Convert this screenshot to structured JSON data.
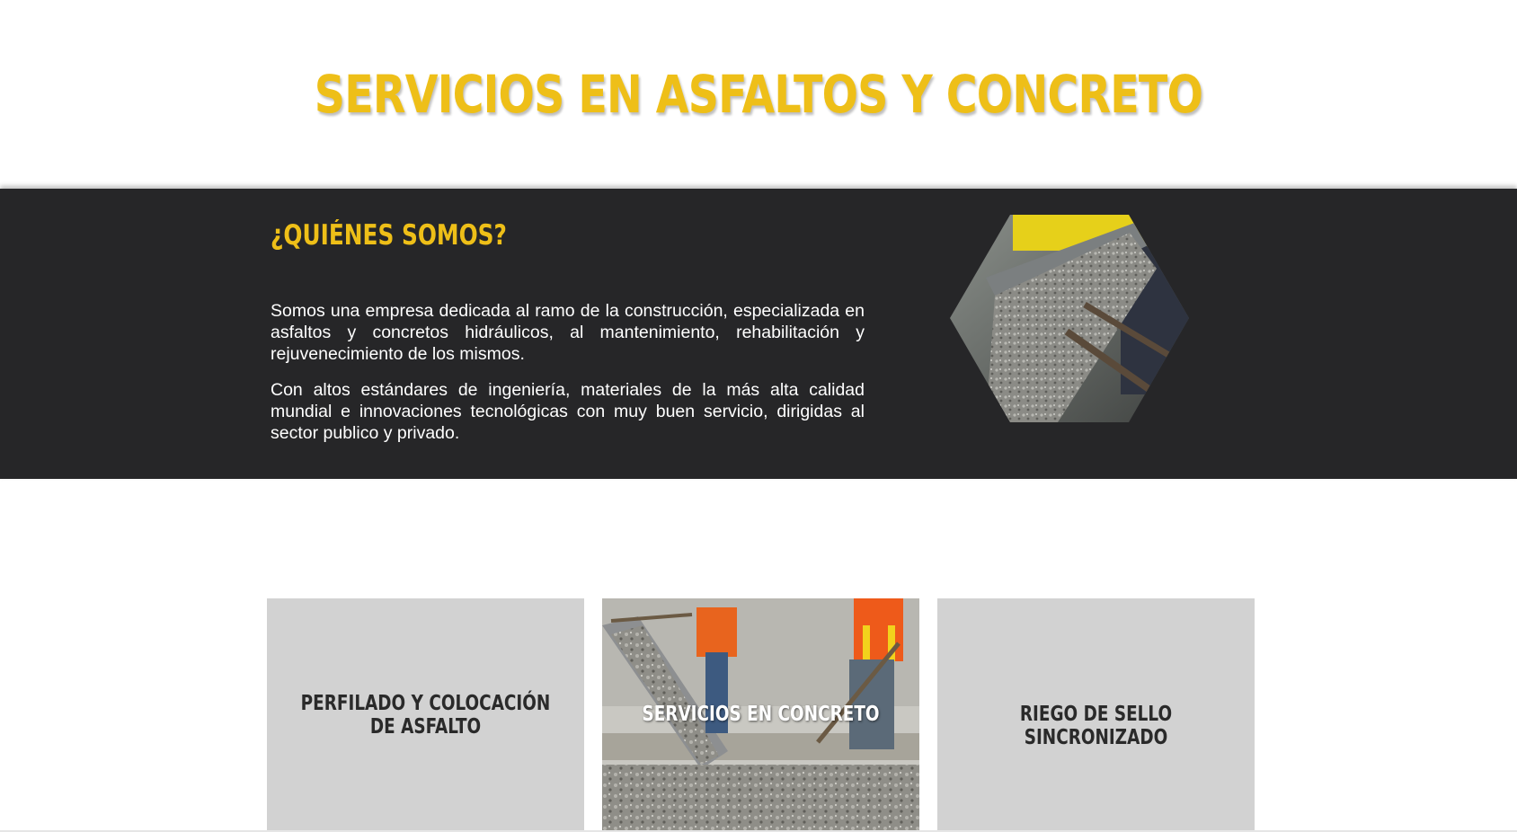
{
  "hero": {
    "title": "SERVICIOS EN ASFALTOS Y CONCRETO"
  },
  "about": {
    "heading": "¿QUIÉNES SOMOS?",
    "paragraphs": [
      "Somos una empresa dedicada al ramo de la construcción, especializada en asfaltos y concretos hidráulicos, al mantenimiento, rehabilitación y rejuvenecimiento de los mismos.",
      "Con altos estándares de ingeniería, materiales de la más alta calidad mundial e innovaciones tecnológicas con muy buen servicio, dirigidas al sector publico y privado."
    ]
  },
  "services": [
    {
      "label": "PERFILADO Y COLOCACIÓN DE ASFALTO"
    },
    {
      "label": "SERVICIOS EN CONCRETO"
    },
    {
      "label": "RIEGO DE SELLO SINCRONIZADO"
    }
  ],
  "colors": {
    "accent": "#eebf18",
    "dark_band": "#262628",
    "card_bg": "#d2d2d2"
  }
}
